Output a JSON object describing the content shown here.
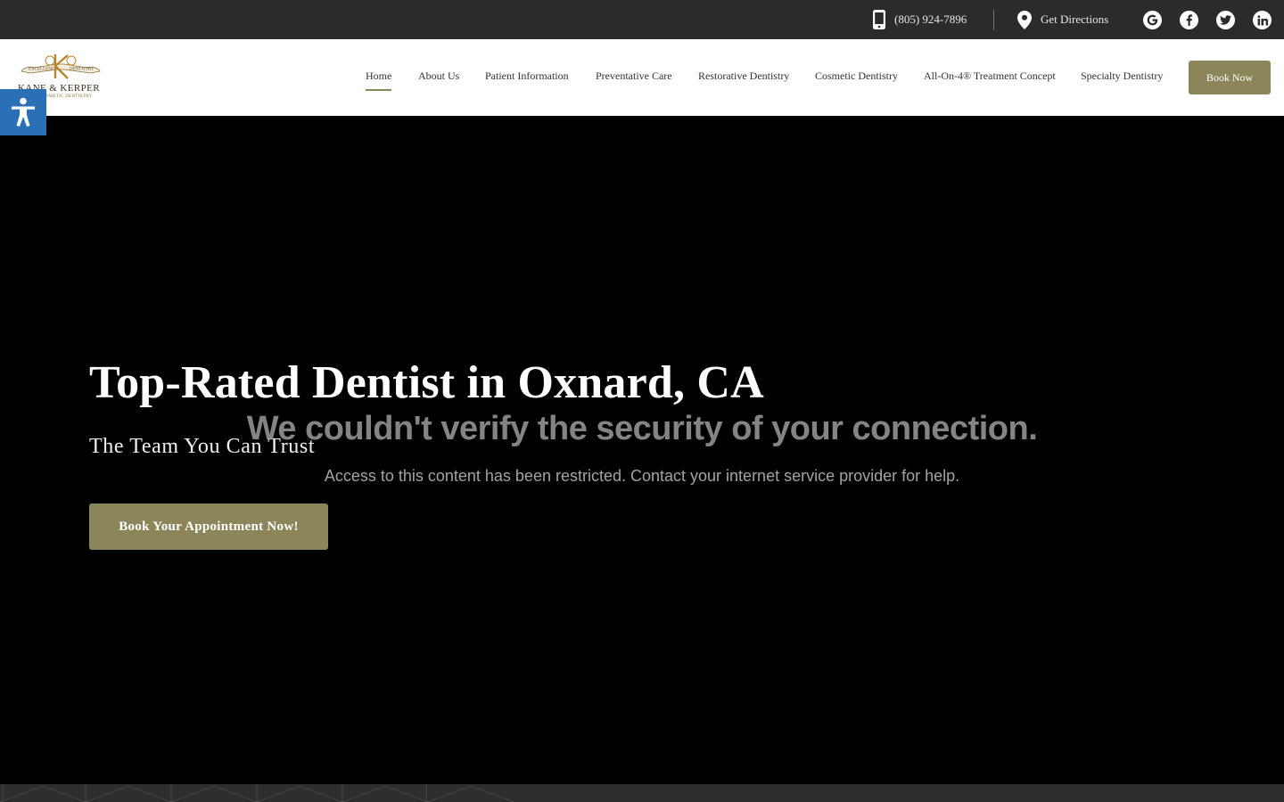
{
  "topbar": {
    "phone": "(805) 924-7896",
    "directions": "Get Directions",
    "social_icons": [
      "google-icon",
      "facebook-icon",
      "twitter-icon",
      "linkedin-icon"
    ]
  },
  "header": {
    "logo": {
      "name": "KANE & KERPER",
      "tagline": "COSMETIC DENTISTRY",
      "banner": "EXCELLENCE IN DENTISTRY"
    },
    "nav": [
      {
        "label": "Home",
        "active": true
      },
      {
        "label": "About Us"
      },
      {
        "label": "Patient Information"
      },
      {
        "label": "Preventative Care"
      },
      {
        "label": "Restorative Dentistry"
      },
      {
        "label": "Cosmetic Dentistry"
      },
      {
        "label": "All-On-4® Treatment Concept"
      },
      {
        "label": "Specialty Dentistry"
      }
    ],
    "book_now": "Book Now"
  },
  "hero": {
    "title": "Top-Rated Dentist in Oxnard, CA",
    "subtitle": "The Team You Can Trust",
    "cta": "Book Your Appointment Now!"
  },
  "warning": {
    "title": "We couldn't verify the security of your connection.",
    "text": "Access to this content has been restricted. Contact your internet service provider for help."
  },
  "colors": {
    "accent": "#8b8659",
    "topbar": "#2b2b2b",
    "accessibility": "#2b6fb6"
  }
}
